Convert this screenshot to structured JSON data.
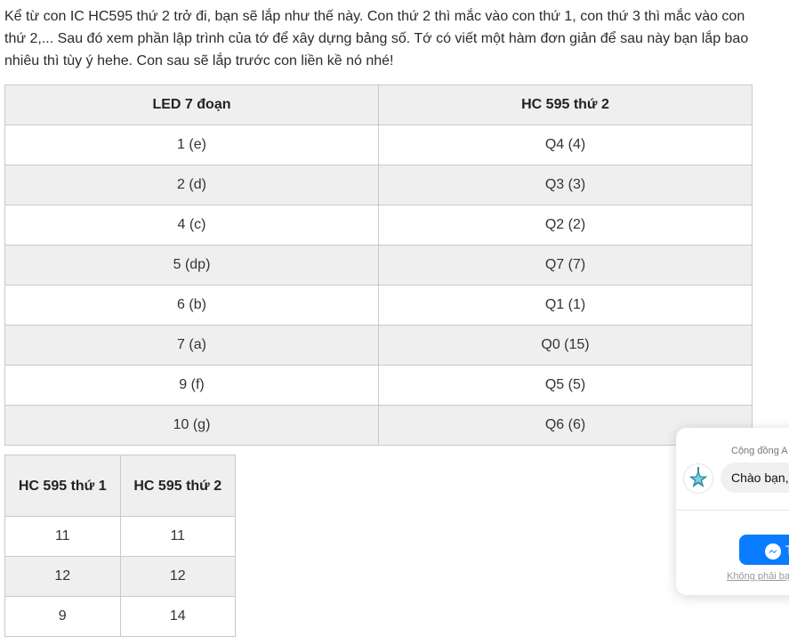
{
  "intro_text": "Kể từ con IC HC595 thứ 2 trở đi, bạn sẽ lắp như thế này. Con thứ 2 thì mắc vào con thứ 1, con thứ 3 thì mắc vào con thứ 2,... Sau đó xem phần lập trình của tớ để xây dựng bảng số. Tớ có viết một hàm đơn giản để sau này bạn lắp bao nhiêu thì tùy ý hehe. Con sau sẽ lắp trước con liền kề nó nhé!",
  "led_table": {
    "headers": [
      "LED 7 đoạn",
      "HC 595 thứ 2"
    ],
    "rows": [
      [
        "1 (e)",
        "Q4 (4)"
      ],
      [
        "2 (d)",
        "Q3 (3)"
      ],
      [
        "4 (c)",
        "Q2 (2)"
      ],
      [
        "5 (dp)",
        "Q7 (7)"
      ],
      [
        "6 (b)",
        "Q1 (1)"
      ],
      [
        "7 (a)",
        "Q0 (15)"
      ],
      [
        "9 (f)",
        "Q5 (5)"
      ],
      [
        "10 (g)",
        "Q6 (6)"
      ]
    ]
  },
  "hc_table": {
    "headers": [
      "HC 595 thứ 1",
      "HC 595 thứ 2"
    ],
    "rows": [
      [
        "11",
        "11"
      ],
      [
        "12",
        "12"
      ],
      [
        "9",
        "14"
      ]
    ]
  },
  "chat": {
    "title": "Cộng đồng A",
    "greeting": "Chào bạn,",
    "button_label": "T",
    "footer_link": "Không phải bạ",
    "icon_avatar": "community-logo",
    "icon_button": "messenger-icon",
    "accent_color": "#0a7cff"
  }
}
